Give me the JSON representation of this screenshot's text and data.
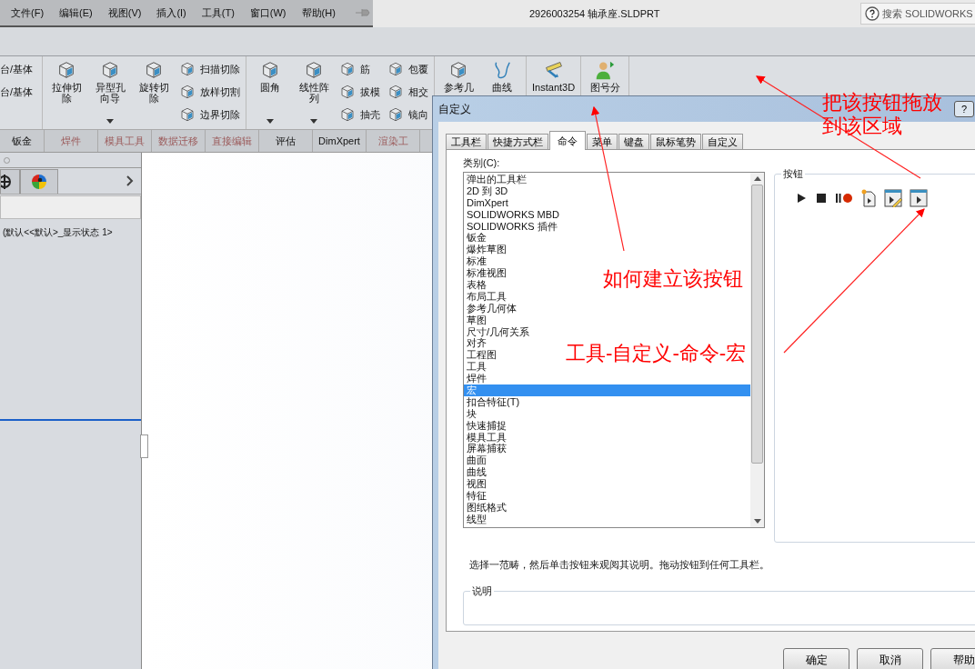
{
  "menu_bar": {
    "items": [
      "文件(F)",
      "编辑(E)",
      "视图(V)",
      "插入(I)",
      "工具(T)",
      "窗口(W)",
      "帮助(H)"
    ]
  },
  "window": {
    "title": "2926003254 轴承座.SLDPRT"
  },
  "search": {
    "placeholder": "搜索 SOLIDWORKS"
  },
  "toolbar": {
    "groups": [
      [
        {
          "kind": "stack",
          "items": [
            {
              "kind": "text",
              "label": "台/基体"
            },
            {
              "kind": "text",
              "label": "台/基体"
            }
          ]
        }
      ],
      [
        {
          "kind": "large",
          "label": "拉伸切除",
          "caret": false
        },
        {
          "kind": "large",
          "label": "异型孔向导",
          "caret": true
        },
        {
          "kind": "large",
          "label": "旋转切除",
          "caret": false
        },
        {
          "kind": "stack",
          "items": [
            {
              "kind": "small",
              "label": "扫描切除"
            },
            {
              "kind": "small",
              "label": "放样切割"
            },
            {
              "kind": "small",
              "label": "边界切除"
            }
          ]
        }
      ],
      [
        {
          "kind": "large",
          "label": "圆角",
          "caret": true
        },
        {
          "kind": "large",
          "label": "线性阵列",
          "caret": true
        },
        {
          "kind": "stack",
          "items": [
            {
              "kind": "small",
              "label": "筋"
            },
            {
              "kind": "small",
              "label": "拔模"
            },
            {
              "kind": "small",
              "label": "抽壳"
            }
          ]
        },
        {
          "kind": "stack",
          "items": [
            {
              "kind": "small",
              "label": "包覆"
            },
            {
              "kind": "small",
              "label": "相交"
            },
            {
              "kind": "small",
              "label": "镜向"
            }
          ]
        }
      ],
      [
        {
          "kind": "large",
          "label": "参考几",
          "caret": false
        },
        {
          "kind": "large",
          "label": "曲线",
          "caret": false
        }
      ],
      [
        {
          "kind": "large",
          "label": "Instant3D",
          "caret": false
        }
      ],
      [
        {
          "kind": "large",
          "label": "图号分",
          "caret": false
        }
      ]
    ]
  },
  "feature_tabs": [
    {
      "label": "钣金",
      "dimmed": false
    },
    {
      "label": "焊件",
      "dimmed": true
    },
    {
      "label": "模具工具",
      "dimmed": true
    },
    {
      "label": "数据迁移",
      "dimmed": true
    },
    {
      "label": "直接编辑",
      "dimmed": true
    },
    {
      "label": "评估",
      "dimmed": false
    },
    {
      "label": "DimXpert",
      "dimmed": false
    },
    {
      "label": "渲染工",
      "dimmed": true
    }
  ],
  "left_panel": {
    "tree_item": "(默认<<默认>_显示状态 1>"
  },
  "dialog": {
    "title": "自定义",
    "help": "?",
    "tabs": [
      {
        "label": "工具栏",
        "selected": false
      },
      {
        "label": "快捷方式栏",
        "selected": false
      },
      {
        "label": "命令",
        "selected": true
      },
      {
        "label": "菜单",
        "selected": false
      },
      {
        "label": "键盘",
        "selected": false
      },
      {
        "label": "鼠标笔势",
        "selected": false
      },
      {
        "label": "自定义",
        "selected": false
      }
    ],
    "category_label": "类别(C):",
    "categories": [
      {
        "label": "弹出的工具栏",
        "selected": false
      },
      {
        "label": "2D 到 3D",
        "selected": false
      },
      {
        "label": "DimXpert",
        "selected": false
      },
      {
        "label": "SOLIDWORKS MBD",
        "selected": false
      },
      {
        "label": "SOLIDWORKS 插件",
        "selected": false
      },
      {
        "label": "钣金",
        "selected": false
      },
      {
        "label": "爆炸草图",
        "selected": false
      },
      {
        "label": "标准",
        "selected": false
      },
      {
        "label": "标准视图",
        "selected": false
      },
      {
        "label": "表格",
        "selected": false
      },
      {
        "label": "布局工具",
        "selected": false
      },
      {
        "label": "参考几何体",
        "selected": false
      },
      {
        "label": "草图",
        "selected": false
      },
      {
        "label": "尺寸/几何关系",
        "selected": false
      },
      {
        "label": "对齐",
        "selected": false
      },
      {
        "label": "工程图",
        "selected": false
      },
      {
        "label": "工具",
        "selected": false
      },
      {
        "label": "焊件",
        "selected": false
      },
      {
        "label": "宏",
        "selected": true
      },
      {
        "label": "扣合特征(T)",
        "selected": false
      },
      {
        "label": "块",
        "selected": false
      },
      {
        "label": "快速捕捉",
        "selected": false
      },
      {
        "label": "模具工具",
        "selected": false
      },
      {
        "label": "屏幕捕获",
        "selected": false
      },
      {
        "label": "曲面",
        "selected": false
      },
      {
        "label": "曲线",
        "selected": false
      },
      {
        "label": "视图",
        "selected": false
      },
      {
        "label": "特征",
        "selected": false
      },
      {
        "label": "图纸格式",
        "selected": false
      },
      {
        "label": "线型",
        "selected": false
      }
    ],
    "buttons_group": "按钮",
    "hint": "选择一范畴，然后单击按钮来观阅其说明。拖动按钮到任何工具栏。",
    "description_group": "说明",
    "actions": [
      "确定",
      "取消",
      "帮助"
    ]
  },
  "annotations": [
    {
      "text": "把该按钮拖放到该区域"
    },
    {
      "text": "如何建立该按钮"
    },
    {
      "text": "工具-自定义-命令-宏"
    }
  ]
}
